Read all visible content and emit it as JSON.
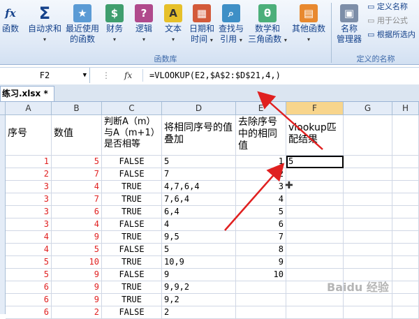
{
  "ribbon": {
    "buttons": [
      {
        "label": "函数",
        "label2": ""
      },
      {
        "label": "自动求和",
        "label2": ""
      },
      {
        "label": "最近使用",
        "label2": "的函数"
      },
      {
        "label": "财务",
        "label2": ""
      },
      {
        "label": "逻辑",
        "label2": ""
      },
      {
        "label": "文本",
        "label2": ""
      },
      {
        "label": "日期和",
        "label2": "时间"
      },
      {
        "label": "查找与",
        "label2": "引用"
      },
      {
        "label": "数学和",
        "label2": "三角函数"
      },
      {
        "label": "其他函数",
        "label2": ""
      },
      {
        "label": "名称",
        "label2": "管理器"
      }
    ],
    "icon_glyphs": {
      "fx": "fx",
      "sigma": "Σ",
      "star": "★",
      "finance": "$",
      "logic": "?",
      "text": "A",
      "date": "▦",
      "lookup": "⌕",
      "math": "θ",
      "more": "▤",
      "names": "▣"
    },
    "group_library": "函数库",
    "group_names": "定义的名称",
    "names_items": [
      "定义名称",
      "用于公式",
      "根据所选内"
    ]
  },
  "formula_bar": {
    "name_box": "F2",
    "fx": "fx",
    "formula": "=VLOOKUP(E2,$A$2:$D$21,4,)"
  },
  "tab": {
    "file": "练习.xlsx *"
  },
  "columns": [
    "A",
    "B",
    "C",
    "D",
    "E",
    "F",
    "G",
    "H"
  ],
  "headers": {
    "A": "序号",
    "B": "数值",
    "C": "判断A（m）与A（m+1）是否相等",
    "D": "将相同序号的值叠加",
    "E": "去除序号中的相同值",
    "F": "vlookup匹配结果"
  },
  "rows": [
    {
      "a": "1",
      "b": "5",
      "c": "FALSE",
      "d": "5",
      "e": "1",
      "f": "5"
    },
    {
      "a": "2",
      "b": "7",
      "c": "FALSE",
      "d": "7",
      "e": "2",
      "f": ""
    },
    {
      "a": "3",
      "b": "4",
      "c": "TRUE",
      "d": "4,7,6,4",
      "e": "3",
      "f": ""
    },
    {
      "a": "3",
      "b": "7",
      "c": "TRUE",
      "d": "7,6,4",
      "e": "4",
      "f": ""
    },
    {
      "a": "3",
      "b": "6",
      "c": "TRUE",
      "d": "6,4",
      "e": "5",
      "f": ""
    },
    {
      "a": "3",
      "b": "4",
      "c": "FALSE",
      "d": "4",
      "e": "6",
      "f": ""
    },
    {
      "a": "4",
      "b": "9",
      "c": "TRUE",
      "d": "9,5",
      "e": "7",
      "f": ""
    },
    {
      "a": "4",
      "b": "5",
      "c": "FALSE",
      "d": "5",
      "e": "8",
      "f": ""
    },
    {
      "a": "5",
      "b": "10",
      "c": "TRUE",
      "d": "10,9",
      "e": "9",
      "f": ""
    },
    {
      "a": "5",
      "b": "9",
      "c": "FALSE",
      "d": "9",
      "e": "10",
      "f": ""
    },
    {
      "a": "6",
      "b": "9",
      "c": "TRUE",
      "d": "9,9,2",
      "e": "",
      "f": ""
    },
    {
      "a": "6",
      "b": "9",
      "c": "TRUE",
      "d": "9,2",
      "e": "",
      "f": ""
    },
    {
      "a": "6",
      "b": "2",
      "c": "FALSE",
      "d": "2",
      "e": "",
      "f": ""
    }
  ],
  "colors": {
    "red_text": "#e02020",
    "arrow": "#e02020",
    "selected_header": "#f8d58c"
  },
  "watermark": "Baidu 经验"
}
